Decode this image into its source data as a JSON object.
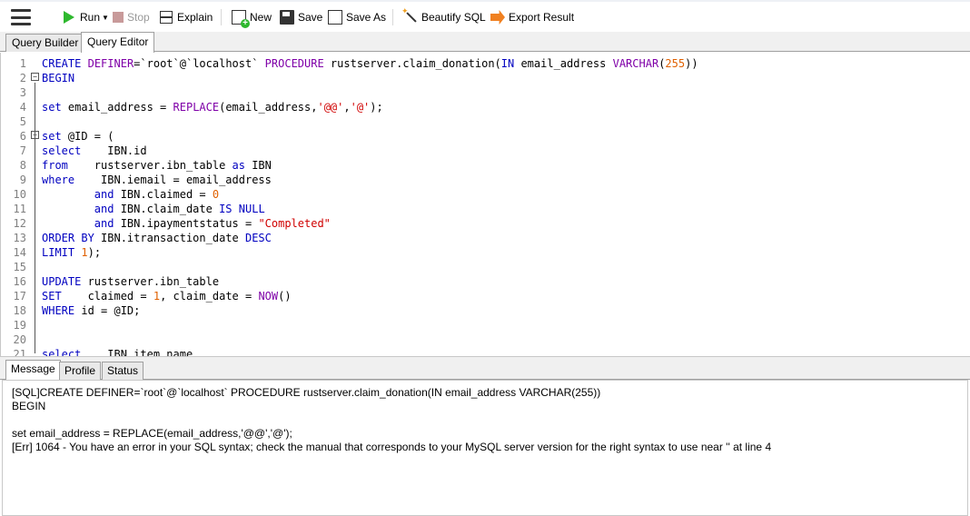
{
  "toolbar": {
    "run_label": "Run",
    "stop_label": "Stop",
    "explain_label": "Explain",
    "new_label": "New",
    "save_label": "Save",
    "save_as_label": "Save As",
    "beautify_label": "Beautify SQL",
    "export_label": "Export Result"
  },
  "tabs": {
    "query_builder": "Query Builder",
    "query_editor": "Query Editor",
    "active": "Query Editor"
  },
  "editor": {
    "lines": [
      {
        "n": "1",
        "text": "CREATE DEFINER=`root`@`localhost` PROCEDURE rustserver.claim_donation(IN email_address VARCHAR(255))"
      },
      {
        "n": "2",
        "text": "BEGIN"
      },
      {
        "n": "3",
        "text": ""
      },
      {
        "n": "4",
        "text": "set email_address = REPLACE(email_address,'@@','@');"
      },
      {
        "n": "5",
        "text": ""
      },
      {
        "n": "6",
        "text": "set @ID = ("
      },
      {
        "n": "7",
        "text": "select    IBN.id"
      },
      {
        "n": "8",
        "text": "from    rustserver.ibn_table as IBN"
      },
      {
        "n": "9",
        "text": "where    IBN.iemail = email_address"
      },
      {
        "n": "10",
        "text": "        and IBN.claimed = 0"
      },
      {
        "n": "11",
        "text": "        and IBN.claim_date IS NULL"
      },
      {
        "n": "12",
        "text": "        and IBN.ipaymentstatus = \"Completed\""
      },
      {
        "n": "13",
        "text": "ORDER BY IBN.itransaction_date DESC"
      },
      {
        "n": "14",
        "text": "LIMIT 1);"
      },
      {
        "n": "15",
        "text": ""
      },
      {
        "n": "16",
        "text": "UPDATE rustserver.ibn_table"
      },
      {
        "n": "17",
        "text": "SET    claimed = 1, claim_date = NOW()"
      },
      {
        "n": "18",
        "text": "WHERE id = @ID;"
      },
      {
        "n": "19",
        "text": ""
      },
      {
        "n": "20",
        "text": ""
      },
      {
        "n": "21",
        "text": "select    IBN.item_name"
      }
    ]
  },
  "message_tabs": {
    "message": "Message",
    "profile": "Profile",
    "status": "Status",
    "active": "Message"
  },
  "messages": [
    "[SQL]CREATE DEFINER=`root`@`localhost` PROCEDURE rustserver.claim_donation(IN email_address VARCHAR(255))",
    "BEGIN",
    "",
    "set email_address = REPLACE(email_address,'@@','@');",
    "[Err] 1064 - You have an error in your SQL syntax; check the manual that corresponds to your MySQL server version for the right syntax to use near '' at line 4"
  ],
  "colors": {
    "keyword": "#0000c0",
    "string": "#d00000",
    "number": "#e06000",
    "line_number": "#808080",
    "run_green": "#2eb82e"
  }
}
